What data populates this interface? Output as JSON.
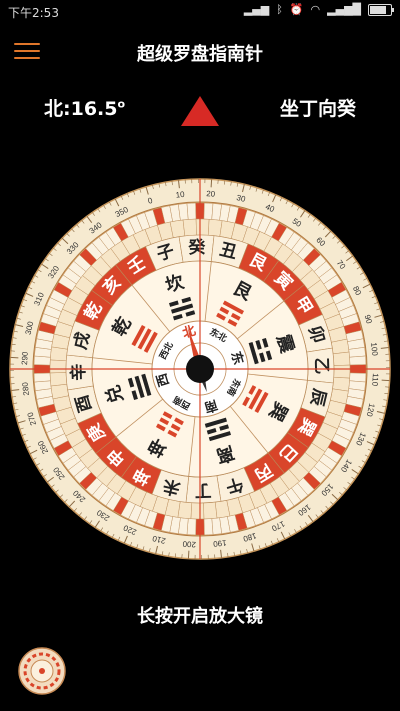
{
  "status": {
    "time": "下午2:53",
    "battery_level": 0.85
  },
  "header": {
    "title": "超级罗盘指南针",
    "menu_icon": "hamburger-menu-icon"
  },
  "readout": {
    "heading_label": "北:16.5",
    "degree_symbol": "o",
    "direction": "坐丁向癸"
  },
  "compass": {
    "heading_deg": 16.5,
    "degree_ticks": [
      "0",
      "10",
      "20",
      "30",
      "40",
      "50",
      "60",
      "70",
      "80",
      "90",
      "100",
      "110",
      "120",
      "130",
      "140",
      "150",
      "160",
      "170",
      "180",
      "190",
      "200",
      "210",
      "220",
      "230",
      "240",
      "250",
      "260",
      "270",
      "280",
      "290",
      "300",
      "310",
      "320",
      "330",
      "340",
      "350"
    ],
    "mountains": [
      "子",
      "癸",
      "丑",
      "艮",
      "寅",
      "甲",
      "卯",
      "乙",
      "辰",
      "巽",
      "巳",
      "丙",
      "午",
      "丁",
      "未",
      "坤",
      "申",
      "庚",
      "酉",
      "辛",
      "戌",
      "乾",
      "亥",
      "壬"
    ],
    "gua_names": [
      "坎",
      "艮",
      "震",
      "巽",
      "离",
      "坤",
      "兑",
      "乾"
    ],
    "directions": [
      "北",
      "东北",
      "东",
      "东南",
      "南",
      "西南",
      "西",
      "西北"
    ],
    "accent_red": "#d9452a",
    "ring_cream": "#f6ead0",
    "ring_tan": "#e9b879"
  },
  "footer": {
    "magnifier_hint": "长按开启放大镜"
  }
}
